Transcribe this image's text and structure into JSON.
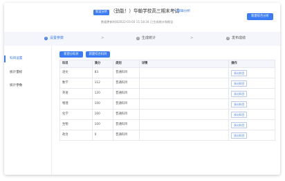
{
  "header": {
    "tag": "新运分析",
    "title": "（劲能！）华翰学校高三期末考试",
    "edit_link": "编辑分析",
    "edit_icon": "edit-icon",
    "subtitle": "数据更新时间2022-03-03 11:18:34  已生成统计和报告",
    "new_button": "新建综合分析"
  },
  "steps": [
    {
      "num": "1",
      "label": "设置参数",
      "active": true
    },
    {
      "num": "2",
      "label": "生成统计",
      "active": false
    },
    {
      "num": "3",
      "label": "发布成绩",
      "active": false
    }
  ],
  "step_separator": ">",
  "sidebar": {
    "items": [
      {
        "label": "科目设置",
        "active": true
      },
      {
        "label": "统计量标"
      },
      {
        "label": "统计参数"
      }
    ]
  },
  "toolbar": {
    "add_subject": "新建分科目",
    "add_group": "新建综合科目"
  },
  "table": {
    "headers": [
      "科目",
      "满分",
      "类别",
      "详情",
      "操作"
    ],
    "rows": [
      {
        "subject": "语文",
        "score": "83",
        "type": "普通科目",
        "detail": "",
        "action": "拆分科目"
      },
      {
        "subject": "数学",
        "score": "112",
        "type": "普通科目",
        "detail": "",
        "action": "拆分科目"
      },
      {
        "subject": "英语",
        "score": "120",
        "type": "普通科目",
        "detail": "",
        "action": "拆分科目"
      },
      {
        "subject": "物理",
        "score": "100",
        "type": "普通科目",
        "detail": "",
        "action": "拆分科目"
      },
      {
        "subject": "化学",
        "score": "100",
        "type": "普通科目",
        "detail": "",
        "action": "拆分科目"
      },
      {
        "subject": "生物",
        "score": "100",
        "type": "普通科目",
        "detail": "",
        "action": "拆分科目"
      },
      {
        "subject": "政治",
        "score": "0",
        "type": "普通科目",
        "detail": "",
        "action": "拆分科目"
      }
    ]
  },
  "colors": {
    "accent": "#3b7cf5",
    "header_bg": "#f4f6fb",
    "border": "#e6e8ee"
  }
}
